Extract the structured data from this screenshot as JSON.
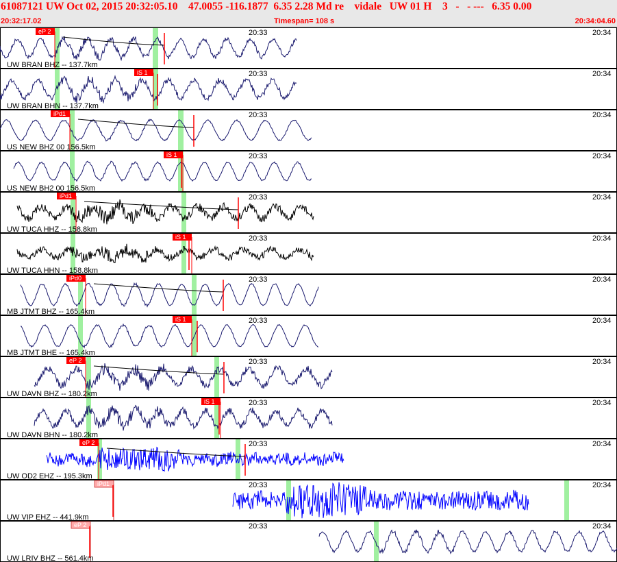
{
  "header": {
    "summary": "61087121 UW Oct 02, 2015 20:32:05.10    47.0055 -116.1877  6.35 2.28 Md re    vidale   UW 01 H    3   -   - ---   6.35 0.00",
    "start_time": "20:32:17.02",
    "timespan": "Timespan= 108 s",
    "end_time": "20:34:04.60"
  },
  "colors": {
    "trace_navy": "#1a1a6e",
    "trace_black": "#000000",
    "trace_blue": "#0000ff",
    "pick_red": "#ff0000",
    "pick_pink": "#ffaaaa",
    "window_green": "#a0f0a0",
    "header_bg": "#e8e8e8",
    "header_text": "#ff0000"
  },
  "panels": [
    {
      "label": "UW BRAN BHZ -- 137.7km",
      "t1": "20:33",
      "t2": "20:34",
      "pick": "eP 2",
      "pick_style": "solid",
      "color": "#1a1a6e",
      "amp": 22,
      "noise": 3,
      "start": 0,
      "end": 433
    },
    {
      "label": "UW BRAN BHN -- 137.7km",
      "t1": "20:33",
      "t2": "20:34",
      "pick": "iS 1",
      "pick_style": "solid",
      "color": "#1a1a6e",
      "amp": 22,
      "noise": 4,
      "start": 0,
      "end": 433
    },
    {
      "label": "US NEW BHZ 00 156.5km",
      "t1": "20:33",
      "t2": "20:34",
      "pick": "iPd1",
      "pick_style": "solid",
      "color": "#1a1a6e",
      "amp": 24,
      "noise": 1,
      "start": 0,
      "end": 455
    },
    {
      "label": "US NEW BH2 00 156.5km",
      "t1": "20:33",
      "t2": "20:34",
      "pick": "iS 1",
      "pick_style": "solid",
      "color": "#1a1a6e",
      "amp": 22,
      "noise": 1,
      "start": 20,
      "end": 455
    },
    {
      "label": "UW TUCA HHZ -- 158.8km",
      "t1": "20:33",
      "t2": "20:34",
      "pick": "iPd1",
      "pick_style": "solid",
      "color": "#000000",
      "amp": 14,
      "noise": 6,
      "start": 25,
      "end": 458
    },
    {
      "label": "UW TUCA HHN -- 158.8km",
      "t1": "20:33",
      "t2": "20:34",
      "pick": "iS 1",
      "pick_style": "solid",
      "color": "#000000",
      "amp": 10,
      "noise": 5,
      "start": 25,
      "end": 458
    },
    {
      "label": "MB JTMT BHZ -- 165.4km",
      "t1": "20:33",
      "t2": "20:34",
      "pick": "iPd0",
      "pick_style": "solid",
      "color": "#1a1a6e",
      "amp": 26,
      "noise": 1,
      "start": 30,
      "end": 465
    },
    {
      "label": "MB JTMT BHE -- 165.4km",
      "t1": "20:33",
      "t2": "20:34",
      "pick": "iS 1",
      "pick_style": "solid",
      "color": "#1a1a6e",
      "amp": 26,
      "noise": 1,
      "start": 30,
      "end": 465
    },
    {
      "label": "UW DAVN BHZ -- 180.2km",
      "t1": "20:33",
      "t2": "20:34",
      "pick": "eP 2",
      "pick_style": "solid",
      "color": "#1a1a6e",
      "amp": 20,
      "noise": 5,
      "start": 50,
      "end": 485
    },
    {
      "label": "UW DAVN BHN -- 180.2km",
      "t1": "20:33",
      "t2": "20:34",
      "pick": "iS 1",
      "pick_style": "solid",
      "color": "#1a1a6e",
      "amp": 18,
      "noise": 5,
      "start": 50,
      "end": 485
    },
    {
      "label": "UW OD2 EHZ -- 195.3km",
      "t1": "20:33",
      "t2": "20:34",
      "pick": "eP 2",
      "pick_style": "solid",
      "color": "#0000ff",
      "amp": 4,
      "noise": 9,
      "start": 68,
      "end": 502
    },
    {
      "label": "UW VIP EHZ -- 441.9km",
      "t1": "20:33",
      "t2": "20:34",
      "pick": "iPd1",
      "pick_style": "light",
      "color": "#0000ff",
      "amp": 3,
      "noise": 14,
      "start": 340,
      "end": 772
    },
    {
      "label": "UW LRIV BHZ -- 561.4km",
      "t1": "20:33",
      "t2": "20:34",
      "pick": "eP 2",
      "pick_style": "light",
      "color": "#1a1a6e",
      "amp": 24,
      "noise": 2,
      "start": 466,
      "end": 901
    }
  ]
}
